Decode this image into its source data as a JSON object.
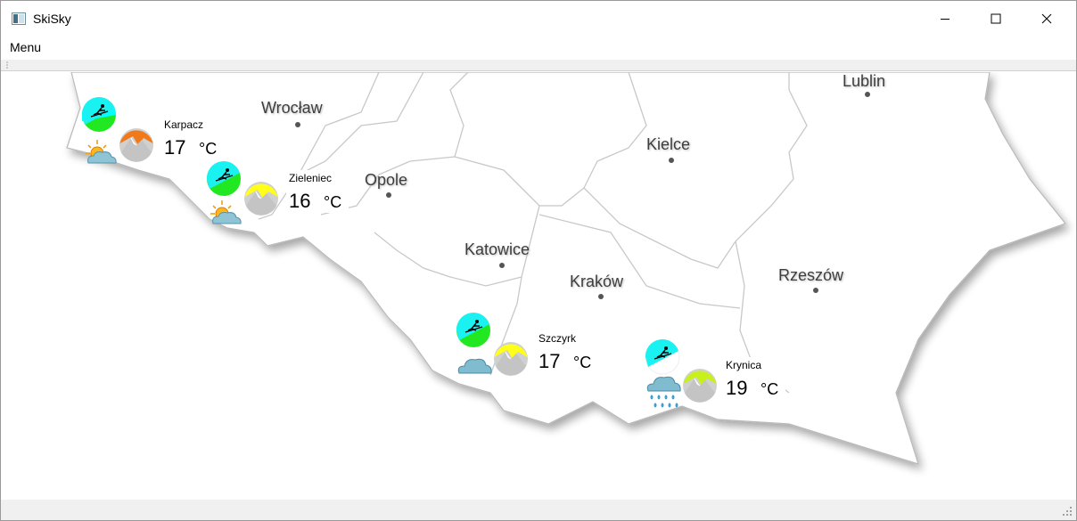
{
  "window": {
    "title": "SkiSky"
  },
  "menubar": {
    "menu_label": "Menu"
  },
  "map": {
    "cities": [
      {
        "name": "Wrocław"
      },
      {
        "name": "Opole"
      },
      {
        "name": "Katowice"
      },
      {
        "name": "Kraków"
      },
      {
        "name": "Kielce"
      },
      {
        "name": "Lublin"
      },
      {
        "name": "Rzeszów"
      }
    ],
    "resorts": [
      {
        "name": "Karpacz",
        "temperature": "17",
        "unit": "°C",
        "conditions_icon": "ski-slope-icon",
        "mountain_icon": "mountain-orange-icon",
        "weather_icon": "sun-behind-cloud-icon",
        "ski_color": "#22e822",
        "mountain_color": "#f07a1a"
      },
      {
        "name": "Zieleniec",
        "temperature": "16",
        "unit": "°C",
        "conditions_icon": "ski-slope-icon",
        "mountain_icon": "mountain-yellow-icon",
        "weather_icon": "sun-behind-cloud-icon",
        "ski_color": "#22e822",
        "mountain_color": "#ffff1a"
      },
      {
        "name": "Szczyrk",
        "temperature": "17",
        "unit": "°C",
        "conditions_icon": "ski-slope-icon",
        "mountain_icon": "mountain-yellow-icon",
        "weather_icon": "cloud-icon",
        "ski_color": "#22e822",
        "mountain_color": "#ffff1a"
      },
      {
        "name": "Krynica",
        "temperature": "19",
        "unit": "°C",
        "conditions_icon": "ski-slope-icon",
        "mountain_icon": "mountain-lime-icon",
        "weather_icon": "rain-cloud-icon",
        "ski_color": "#ffffff",
        "mountain_color": "#c8f01a"
      }
    ]
  }
}
